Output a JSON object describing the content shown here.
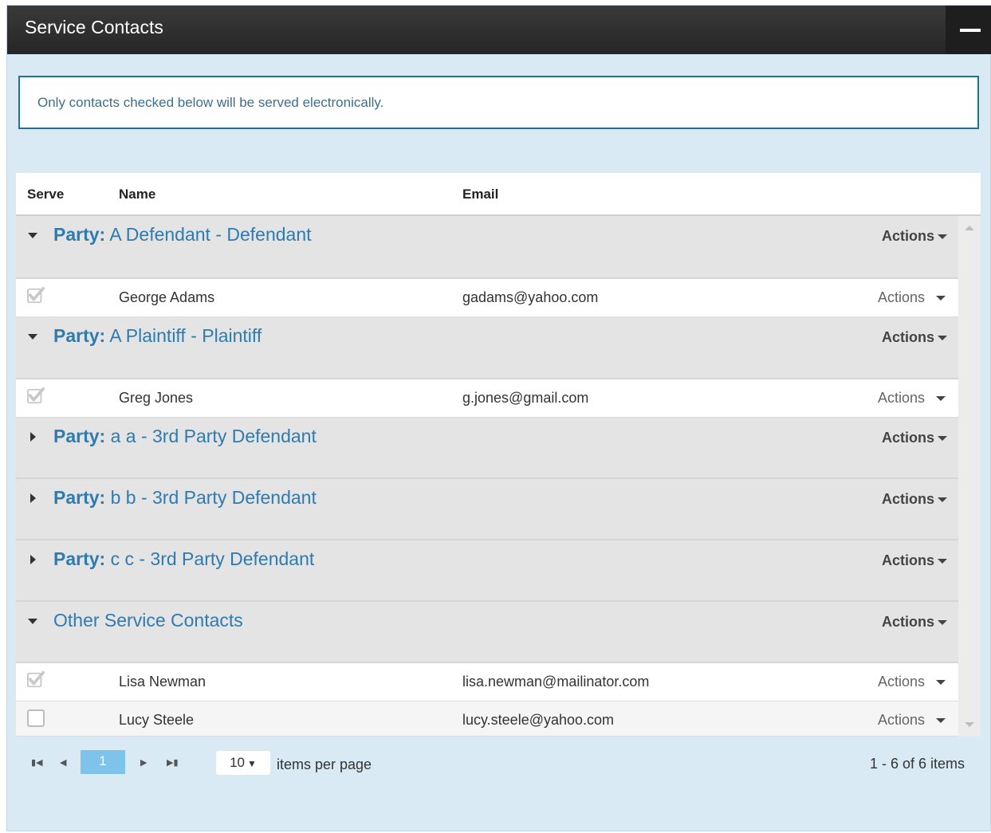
{
  "panel": {
    "title": "Service Contacts",
    "collapse_icon": "minus-icon",
    "notice": "Only contacts checked below will be served electronically."
  },
  "columns": {
    "serve": "Serve",
    "name": "Name",
    "email": "Email"
  },
  "groups": [
    {
      "label": "Party:",
      "title": "A Defendant - Defendant",
      "expanded": true,
      "actions": "Actions",
      "contacts": [
        {
          "name": "George Adams",
          "email": "gadams@yahoo.com",
          "checked": true,
          "actions": "Actions"
        }
      ]
    },
    {
      "label": "Party:",
      "title": "A Plaintiff - Plaintiff",
      "expanded": true,
      "actions": "Actions",
      "contacts": [
        {
          "name": "Greg Jones",
          "email": "g.jones@gmail.com",
          "checked": true,
          "actions": "Actions"
        }
      ]
    },
    {
      "label": "Party:",
      "title": "a a - 3rd Party Defendant",
      "expanded": false,
      "actions": "Actions",
      "contacts": []
    },
    {
      "label": "Party:",
      "title": "b b - 3rd Party Defendant",
      "expanded": false,
      "actions": "Actions",
      "contacts": []
    },
    {
      "label": "Party:",
      "title": "c c - 3rd Party Defendant",
      "expanded": false,
      "actions": "Actions",
      "contacts": []
    },
    {
      "label": "",
      "title": "Other Service Contacts",
      "expanded": true,
      "actions": "Actions",
      "contacts": [
        {
          "name": "Lisa Newman",
          "email": "lisa.newman@mailinator.com",
          "checked": true,
          "actions": "Actions"
        },
        {
          "name": "Lucy Steele",
          "email": "lucy.steele@yahoo.com",
          "checked": false,
          "actions": "Actions"
        }
      ]
    }
  ],
  "pager": {
    "first_icon": "first-page-icon",
    "prev_icon": "previous-page-icon",
    "current_page": "1",
    "next_icon": "next-page-icon",
    "last_icon": "last-page-icon",
    "page_size": "10",
    "page_size_label": "items per page",
    "summary": "1 - 6 of 6 items"
  },
  "colors": {
    "header_bg": "#2f2f2f",
    "panel_bg": "#daeaf5",
    "accent_link": "#2e7bb0",
    "notice_border": "#1f7494",
    "pager_active": "#7ec3ea"
  }
}
